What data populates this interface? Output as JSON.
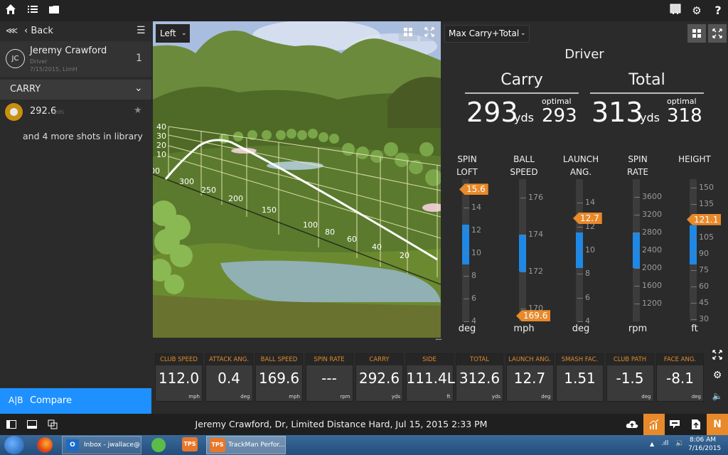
{
  "topbar": {
    "icons": [
      "home-icon",
      "list-icon",
      "folder-icon",
      "screen-icon",
      "gear-icon",
      "help-icon"
    ],
    "help_label": "?"
  },
  "sidebar": {
    "collapse_label": "«‹",
    "back_label": "‹ Back",
    "menu_label": "☰",
    "user": {
      "initials": "JC",
      "name": "Jeremy Crawford",
      "club": "Driver",
      "session": "7/15/2015, LimH",
      "count": "1"
    },
    "group_label": "CARRY",
    "shot": {
      "value": "292.6",
      "unit": "yds"
    },
    "more_label": "and 4 more shots in library",
    "compare_icon": "A|B",
    "compare_label": "Compare"
  },
  "view3d": {
    "view_select": "Left",
    "height_ticks": [
      "40",
      "30",
      "20",
      "10"
    ],
    "distance_ticks": [
      "300",
      "250",
      "200",
      "150",
      "100",
      "80",
      "60",
      "40",
      "20"
    ],
    "clip_label": "00"
  },
  "rpanel": {
    "select_label": "Max Carry+Total",
    "club": "Driver",
    "carry": {
      "title": "Carry",
      "value": "293",
      "unit": "yds",
      "optimal_label": "optimal",
      "optimal": "293"
    },
    "total": {
      "title": "Total",
      "value": "313",
      "unit": "yds",
      "optimal_label": "optimal",
      "optimal": "318"
    },
    "gauges": [
      {
        "title1": "SPIN",
        "title2": "LOFT",
        "unit": "deg",
        "ticks": [
          "14",
          "12",
          "10",
          "8",
          "6",
          "4"
        ],
        "min": 4,
        "max": 16.5,
        "band": [
          9,
          12.5
        ],
        "value": 15.6,
        "value_label": "15.6"
      },
      {
        "title1": "BALL",
        "title2": "SPEED",
        "unit": "mph",
        "ticks": [
          "176",
          "174",
          "172",
          "170"
        ],
        "min": 169.3,
        "max": 177,
        "band": [
          172,
          174
        ],
        "value": 169.6,
        "value_label": "169.6"
      },
      {
        "title1": "LAUNCH",
        "title2": "ANG.",
        "unit": "deg",
        "ticks": [
          "14",
          "12",
          "10",
          "8",
          "6",
          "4"
        ],
        "min": 4,
        "max": 16,
        "band": [
          8.5,
          11.5
        ],
        "value": 12.7,
        "value_label": "12.7"
      },
      {
        "title1": "SPIN",
        "title2": "RATE",
        "unit": "rpm",
        "ticks": [
          "3600",
          "3200",
          "2800",
          "2400",
          "2000",
          "1600",
          "1200"
        ],
        "min": 800,
        "max": 4000,
        "band": [
          2000,
          2800
        ],
        "value": null,
        "value_label": ""
      },
      {
        "title1": "HEIGHT",
        "title2": "",
        "unit": "ft",
        "ticks": [
          "150",
          "135",
          "120",
          "105",
          "90",
          "75",
          "60",
          "45",
          "30"
        ],
        "min": 28,
        "max": 158,
        "band": [
          80,
          116
        ],
        "value": 121.1,
        "value_label": "121.1"
      }
    ]
  },
  "tiles": [
    {
      "label": "CLUB SPEED",
      "value": "112.0",
      "unit": "mph"
    },
    {
      "label": "ATTACK ANG.",
      "value": "0.4",
      "unit": "deg"
    },
    {
      "label": "BALL SPEED",
      "value": "169.6",
      "unit": "mph"
    },
    {
      "label": "SPIN RATE",
      "value": "---",
      "unit": "rpm"
    },
    {
      "label": "CARRY",
      "value": "292.6",
      "unit": "yds"
    },
    {
      "label": "SIDE",
      "value": "111.4L",
      "unit": "ft"
    },
    {
      "label": "TOTAL",
      "value": "312.6",
      "unit": "yds"
    },
    {
      "label": "LAUNCH ANG.",
      "value": "12.7",
      "unit": "deg"
    },
    {
      "label": "SMASH FAC.",
      "value": "1.51",
      "unit": ""
    },
    {
      "label": "CLUB PATH",
      "value": "-1.5",
      "unit": "deg"
    },
    {
      "label": "FACE ANG.",
      "value": "-8.1",
      "unit": "deg"
    }
  ],
  "status": {
    "session_text": "Jeremy Crawford, Dr, Limited Distance Hard, Jul 15, 2015 2:33 PM",
    "n_label": "N"
  },
  "taskbar": {
    "outlook_label": "Inbox - jwallace@...",
    "tps_label": "TPS",
    "trackman_label": "TrackMan Perfor...",
    "time": "8:06 AM",
    "date": "7/16/2015"
  },
  "colors": {
    "accent_blue": "#1e88e5",
    "accent_orange": "#e8892a",
    "background": "#2b2b2b"
  }
}
